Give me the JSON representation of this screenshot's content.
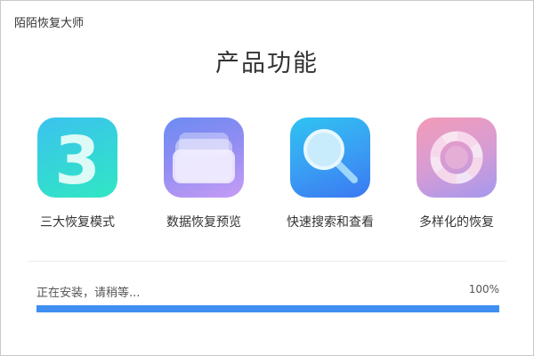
{
  "window": {
    "title": "陌陌恢复大师"
  },
  "page": {
    "title": "产品功能"
  },
  "features": [
    {
      "label": "三大恢复模式",
      "icon": "number-three-icon",
      "icon_text": "3"
    },
    {
      "label": "数据恢复预览",
      "icon": "stacked-cards-icon"
    },
    {
      "label": "快速搜索和查看",
      "icon": "magnifier-icon"
    },
    {
      "label": "多样化的恢复",
      "icon": "ring-icon"
    }
  ],
  "install": {
    "status": "正在安装，请稍等...",
    "progress": 100,
    "progress_label": "100%",
    "bar_color": "#3f8ef2"
  }
}
